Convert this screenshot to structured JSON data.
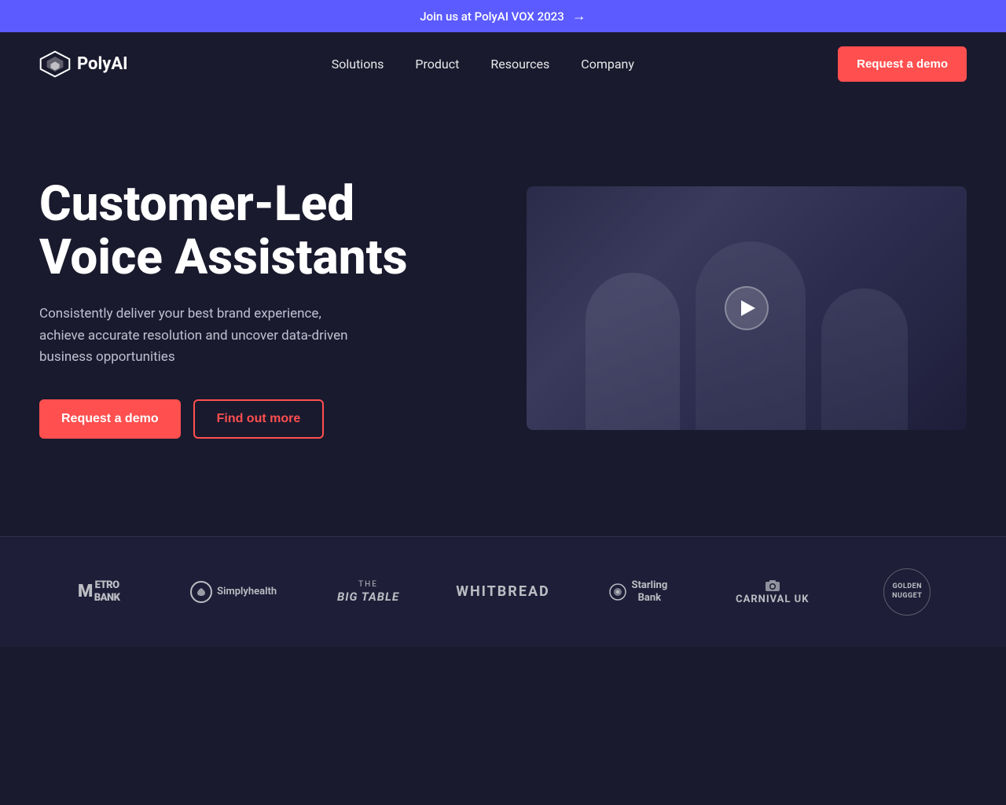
{
  "announcement": {
    "text": "Join us at PolyAI VOX 2023",
    "arrow": "→"
  },
  "nav": {
    "logo_text": "PolyAI",
    "links": [
      {
        "label": "Solutions",
        "id": "solutions"
      },
      {
        "label": "Product",
        "id": "product"
      },
      {
        "label": "Resources",
        "id": "resources"
      },
      {
        "label": "Company",
        "id": "company"
      }
    ],
    "cta_label": "Request a demo"
  },
  "hero": {
    "title_line1": "Customer-Led",
    "title_line2": "Voice Assistants",
    "description": "Consistently deliver your best brand experience, achieve accurate resolution and uncover data-driven business opportunities",
    "btn_primary": "Request a demo",
    "btn_secondary": "Find out more"
  },
  "logos": [
    {
      "id": "metro-bank",
      "label": "METRO\nBANK"
    },
    {
      "id": "simplyhealth",
      "label": "Simplyhealth"
    },
    {
      "id": "big-table",
      "label": "The Big Table"
    },
    {
      "id": "whitbread",
      "label": "WHITBREAD"
    },
    {
      "id": "starling-bank",
      "label": "Starling\nBank"
    },
    {
      "id": "carnival-uk",
      "label": "CARNIVAL UK"
    },
    {
      "id": "golden-nugget",
      "label": "GOLDEN\nNUGGET"
    }
  ],
  "colors": {
    "accent": "#ff4f4f",
    "bg_dark": "#1a1a2e",
    "bg_bar": "#5b5bff"
  }
}
